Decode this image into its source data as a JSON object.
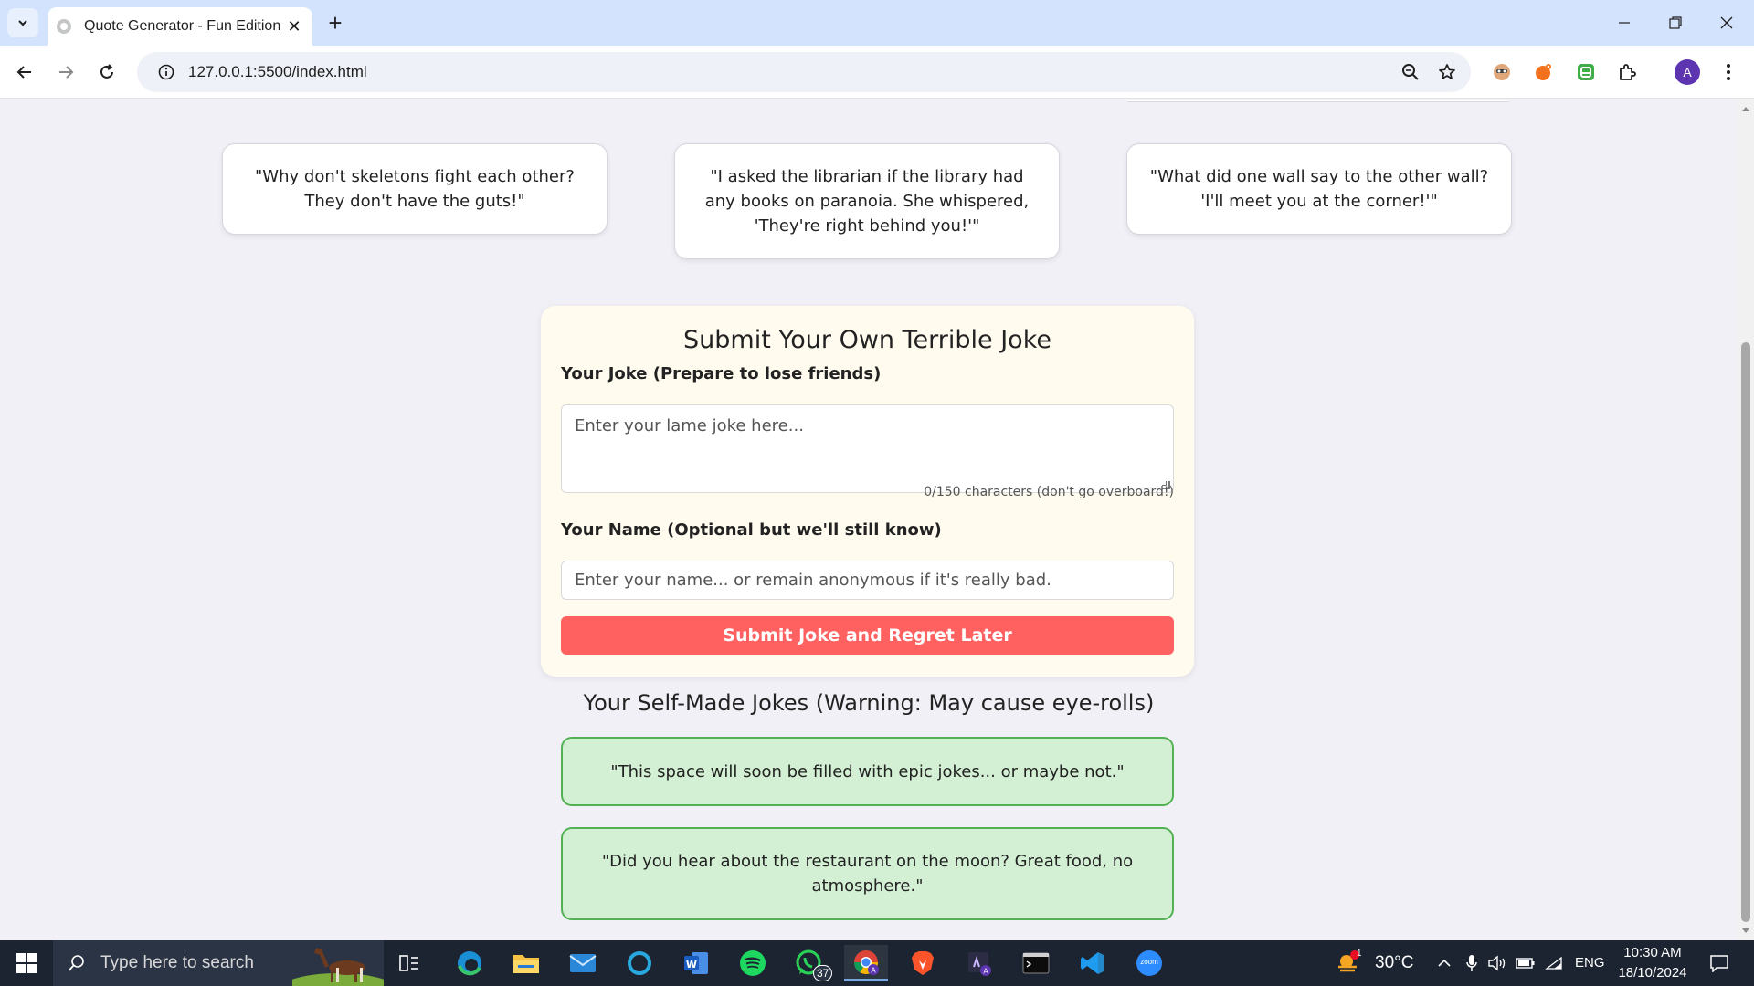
{
  "browser": {
    "tab_title": "Quote Generator - Fun Edition",
    "url": "127.0.0.1:5500/index.html",
    "avatar_letter": "A"
  },
  "page": {
    "joke_cards": [
      {
        "text": "\"Why don't skeletons fight each other? They don't have the guts!\""
      },
      {
        "text": "\"I asked the librarian if the library had any books on paranoia. She whispered, 'They're right behind you!'\""
      },
      {
        "text": "\"What did one wall say to the other wall? 'I'll meet you at the corner!'\""
      }
    ],
    "form": {
      "title": "Submit Your Own Terrible Joke",
      "joke_label": "Your Joke (Prepare to lose friends)",
      "joke_placeholder": "Enter your lame joke here...",
      "char_count": "0/150 characters (don't go overboard!)",
      "name_label": "Your Name (Optional but we'll still know)",
      "name_placeholder": "Enter your name... or remain anonymous if it's really bad.",
      "submit_label": "Submit Joke and Regret Later"
    },
    "self_made": {
      "title": "Your Self-Made Jokes (Warning: May cause eye-rolls)",
      "jokes": [
        {
          "text": "\"This space will soon be filled with epic jokes... or maybe not.\""
        },
        {
          "text": "\"Did you hear about the restaurant on the moon? Great food, no atmosphere.\""
        }
      ]
    }
  },
  "taskbar": {
    "search_placeholder": "Type here to search",
    "whatsapp_badge": "37",
    "weather_temp": "30°C",
    "weather_badge": "1",
    "language": "ENG",
    "time": "10:30 AM",
    "date": "18/10/2024",
    "zoom_label": "zoom"
  },
  "colors": {
    "page_bg": "#f1f0f6",
    "form_bg": "#fffbef",
    "submit_bg": "#ff6161",
    "self_joke_bg": "#d4f0d4",
    "self_joke_border": "#52b152",
    "taskbar_bg": "#1c2431"
  }
}
